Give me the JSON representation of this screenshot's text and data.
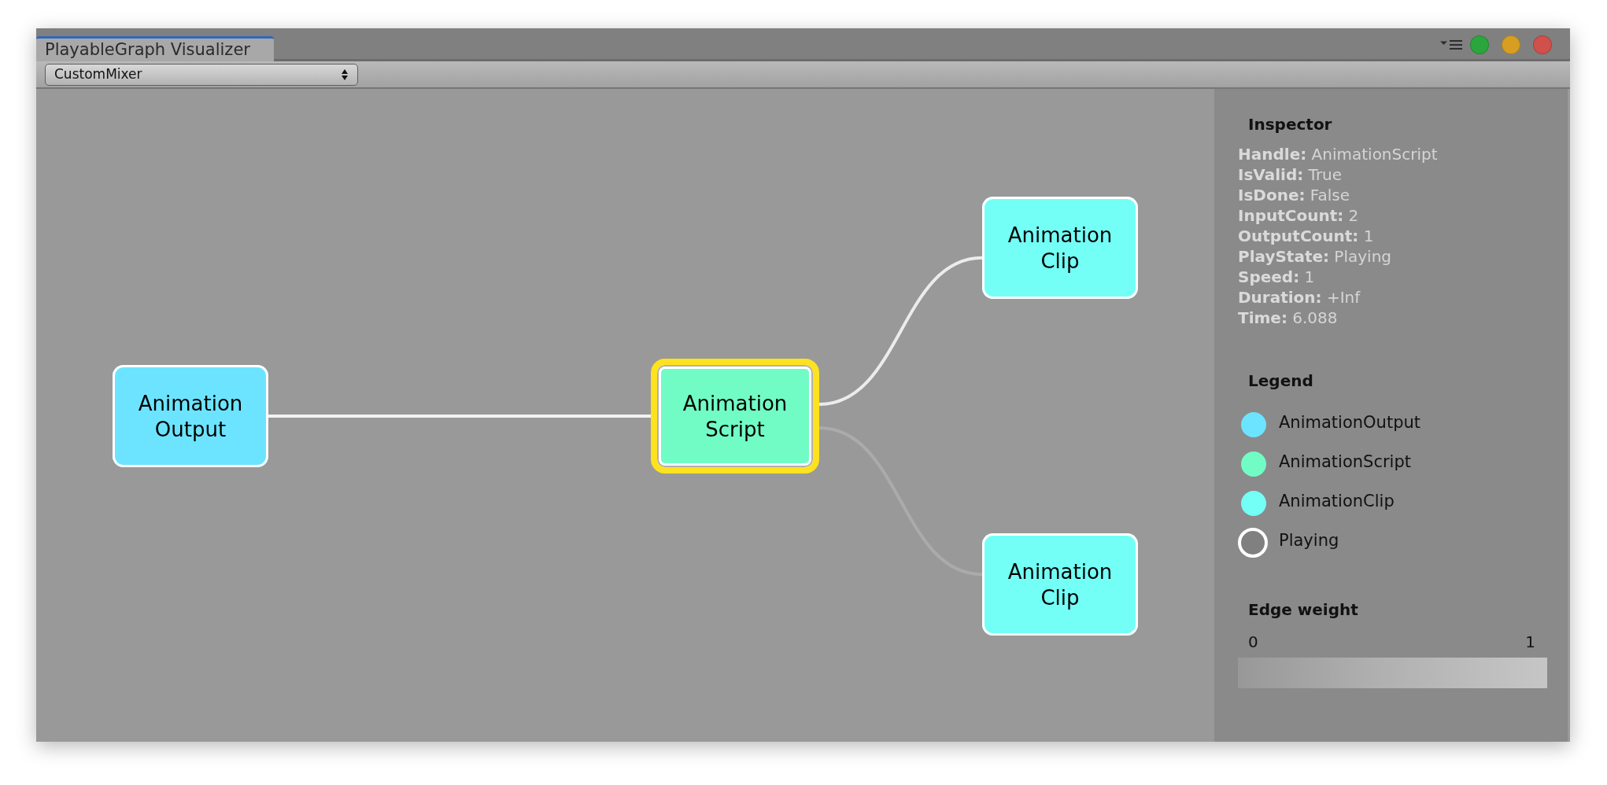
{
  "window": {
    "tabs": [
      {
        "label": "PlayableGraph Visualizer",
        "selected": true
      }
    ]
  },
  "toolbar": {
    "dropdown": {
      "value": "CustomMixer"
    }
  },
  "graph": {
    "nodes": [
      {
        "label": "Animation Output",
        "color": "#6ce4ff",
        "playing": true,
        "selected": false,
        "children": [
          {
            "label": "Animation Script",
            "color": "#71fcc5",
            "playing": true,
            "selected": true,
            "edge": {
              "color": "#f2f2f2"
            },
            "children": [
              {
                "label": "Animation Clip",
                "color": "#73fff6",
                "playing": true,
                "selected": false,
                "edge": {
                  "color": "#ececec"
                }
              },
              {
                "label": "Animation Clip",
                "color": "#73fff6",
                "playing": true,
                "selected": false,
                "edge": {
                  "color": "#ababab"
                }
              }
            ]
          }
        ]
      }
    ]
  },
  "inspector": {
    "title": "Inspector",
    "fields": [
      "**Handle:** AnimationScript",
      "**IsValid:** True",
      "**IsDone:** False",
      "**InputCount:** 2",
      "**OutputCount:** 1",
      "**PlayState:** Playing",
      "**Speed:** 1",
      "**Duration:** +Inf",
      "**Time:** 6.088"
    ]
  },
  "legend": {
    "title": "Legend",
    "items": [
      {
        "kind": "fill",
        "color": "#6ce4ff",
        "label": "AnimationOutput"
      },
      {
        "kind": "fill",
        "color": "#71fcc5",
        "label": "AnimationScript"
      },
      {
        "kind": "fill",
        "color": "#73fff6",
        "label": "AnimationClip"
      },
      {
        "kind": "ring",
        "color": "#ffffff",
        "label": "Playing"
      }
    ]
  },
  "edge_weight": {
    "title": "Edge weight",
    "min_label": "0",
    "max_label": "1"
  }
}
